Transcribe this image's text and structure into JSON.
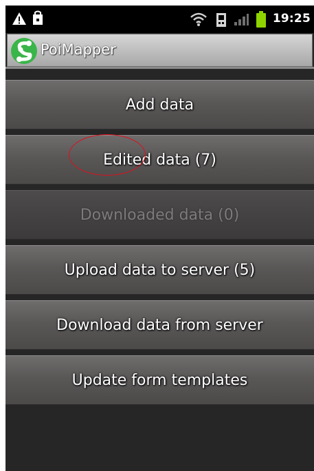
{
  "status_bar": {
    "time": "19:25",
    "left_icons": [
      "warning-icon",
      "bag-icon"
    ],
    "right_icons": [
      "wifi-icon",
      "phone-data-icon",
      "signal-icon",
      "battery-icon"
    ]
  },
  "app": {
    "title": "PoiMapper",
    "logo_icon": "poimapper-logo-icon",
    "logo_color": "#3ab54a"
  },
  "menu": {
    "items": [
      {
        "label": "Add data",
        "enabled": true
      },
      {
        "label": "Edited data (7)",
        "enabled": true
      },
      {
        "label": "Downloaded data (0)",
        "enabled": false
      },
      {
        "label": "Upload data to server (5)",
        "enabled": true
      },
      {
        "label": "Download data from server",
        "enabled": true
      },
      {
        "label": "Update form templates",
        "enabled": true
      }
    ]
  },
  "annotation": {
    "type": "ellipse",
    "color": "#e0101a",
    "target": "Edited data (7)"
  }
}
